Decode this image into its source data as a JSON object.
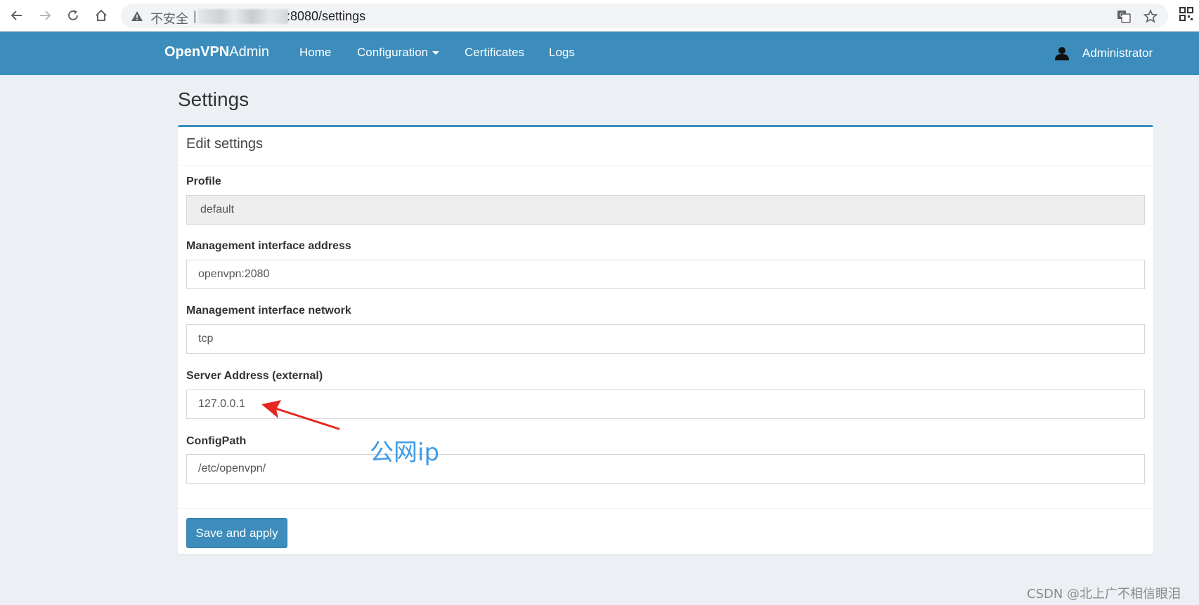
{
  "browser": {
    "insecure_label": "不安全",
    "separator": "|",
    "url_visible": ":8080/settings",
    "icons": [
      "back-arrow-icon",
      "forward-arrow-icon",
      "reload-icon",
      "home-icon",
      "warning-icon",
      "translate-icon",
      "star-icon",
      "qr-code-icon"
    ]
  },
  "navbar": {
    "brand_bold": "OpenVPN",
    "brand_rest": "Admin",
    "links": [
      {
        "label": "Home"
      },
      {
        "label": "Configuration"
      },
      {
        "label": "Certificates"
      },
      {
        "label": "Logs"
      }
    ],
    "user_label": "Administrator",
    "color": "#3c8dbc"
  },
  "page": {
    "title": "Settings",
    "box_title": "Edit settings",
    "fields": [
      {
        "label": "Profile",
        "value": "default",
        "readonly": true
      },
      {
        "label": "Management interface address",
        "value": "openvpn:2080"
      },
      {
        "label": "Management interface network",
        "value": "tcp"
      },
      {
        "label": "Server Address (external)",
        "value": "127.0.0.1"
      },
      {
        "label": "ConfigPath",
        "value": "/etc/openvpn/"
      }
    ],
    "save_button": "Save and apply"
  },
  "annotation": {
    "label": "公网ip",
    "arrow_color": "#e8261f",
    "label_color": "#3f9be6"
  },
  "watermark": "CSDN @北上广不相信眼泪"
}
